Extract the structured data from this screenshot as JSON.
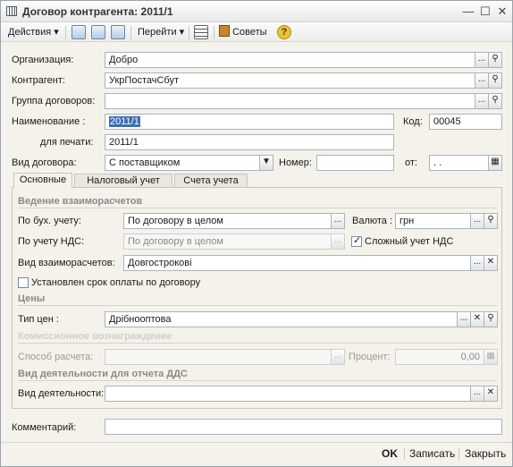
{
  "window": {
    "title": "Договор контрагента: 2011/1"
  },
  "toolbar": {
    "actions_label": "Действия",
    "actions_arrow": "▾",
    "goto_label": "Перейти",
    "goto_arrow": "▾",
    "tips_label": "Советы",
    "help_glyph": "?"
  },
  "header": {
    "organization_label": "Организация:",
    "organization_value": "Добро",
    "counterparty_label": "Контрагент:",
    "counterparty_value": "УкрПостачСбут",
    "group_label": "Группа договоров:",
    "group_value": "",
    "name_label": "Наименование :",
    "name_value": "2011/1",
    "code_label": "Код:",
    "code_value": "00045",
    "print_label": "для печати:",
    "print_value": "2011/1",
    "type_label": "Вид договора:",
    "type_value": "С поставщиком",
    "number_label": "Номер:",
    "number_value": "",
    "from_label": "от:",
    "from_value": " .  ."
  },
  "tabs": [
    {
      "label": "Основные"
    },
    {
      "label": "Налоговый учет"
    },
    {
      "label": "Счета учета"
    }
  ],
  "main": {
    "settlements_title": "Ведение взаиморасчетов",
    "by_accounting_label": "По бух. учету:",
    "by_accounting_value": "По договору в целом",
    "currency_label": "Валюта :",
    "currency_value": "грн",
    "by_vat_label": "По учету НДС:",
    "by_vat_value": "По договору в целом",
    "complex_vat_label": "Сложный  учет НДС",
    "settlement_type_label": "Вид взаиморасчетов:",
    "settlement_type_value": "Довгострокові",
    "payment_term_label": "Установлен срок оплаты по договору",
    "prices_title": "Цены",
    "price_type_label": "Тип цен :",
    "price_type_value": "Дрібнооптова",
    "commission_title": "Комиссионное вознаграждение",
    "calc_method_label": "Способ расчета:",
    "calc_method_value": "",
    "percent_label": "Процент:",
    "percent_value": "0,00",
    "dds_title": "Вид деятельности для отчета ДДС",
    "activity_label": "Вид деятельности:",
    "activity_value": ""
  },
  "comment": {
    "label": "Комментарий:",
    "value": ""
  },
  "footer": {
    "ok_label": "OK",
    "save_label": "Записать",
    "close_label": "Закрыть"
  }
}
